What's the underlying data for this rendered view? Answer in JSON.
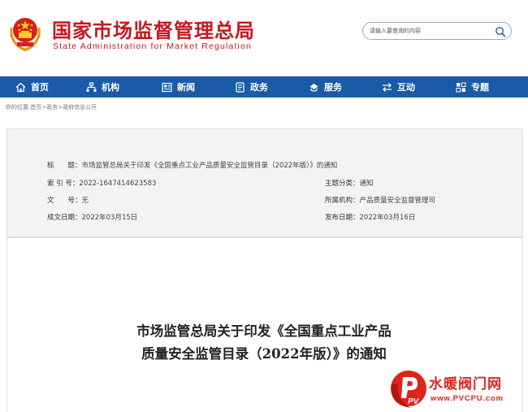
{
  "header": {
    "title": "国家市场监督管理总局",
    "subtitle": "State Administration for Market Regulation",
    "emblem_icon": "national-emblem-icon"
  },
  "search": {
    "placeholder": "请输入要查询的内容",
    "icon": "search-icon"
  },
  "nav": {
    "items": [
      {
        "label": "首页",
        "icon": "home-icon"
      },
      {
        "label": "机构",
        "icon": "org-icon"
      },
      {
        "label": "新闻",
        "icon": "news-icon"
      },
      {
        "label": "政务",
        "icon": "government-icon"
      },
      {
        "label": "服务",
        "icon": "service-icon"
      },
      {
        "label": "互动",
        "icon": "interaction-icon"
      },
      {
        "label": "专题",
        "icon": "topic-icon"
      }
    ],
    "background": "#1b5aa6"
  },
  "breadcrumb": "你的位置:首页>政务>政府信息公开",
  "meta": {
    "title_label": "标　　题：",
    "title_value": "市场监管总局关于印发《全国重点工业产品质量安全监管目录（2022年版）》的通知",
    "index_label": "索 引 号：",
    "index_value": "2022-1647414623583",
    "category_label": "主题分类：",
    "category_value": "通知",
    "docno_label": "文　　号：",
    "docno_value": "无",
    "org_label": "所属机构：",
    "org_value": "产品质量安全监督管理司",
    "created_label": "成文日期：",
    "created_value": "2022年03月15日",
    "published_label": "发布日期：",
    "published_value": "2022年03月16日"
  },
  "document": {
    "title_line1": "市场监管总局关于印发《全国重点工业产品",
    "title_line2": "质量安全监管目录（2022年版）》的通知"
  },
  "watermark": {
    "text": "水暖阀门网",
    "url": "www.PVCPU.com",
    "logo_letters": "PV",
    "color": "#e0231c"
  },
  "colors": {
    "brand_red": "#c8161d",
    "nav_blue": "#1b5aa6"
  }
}
